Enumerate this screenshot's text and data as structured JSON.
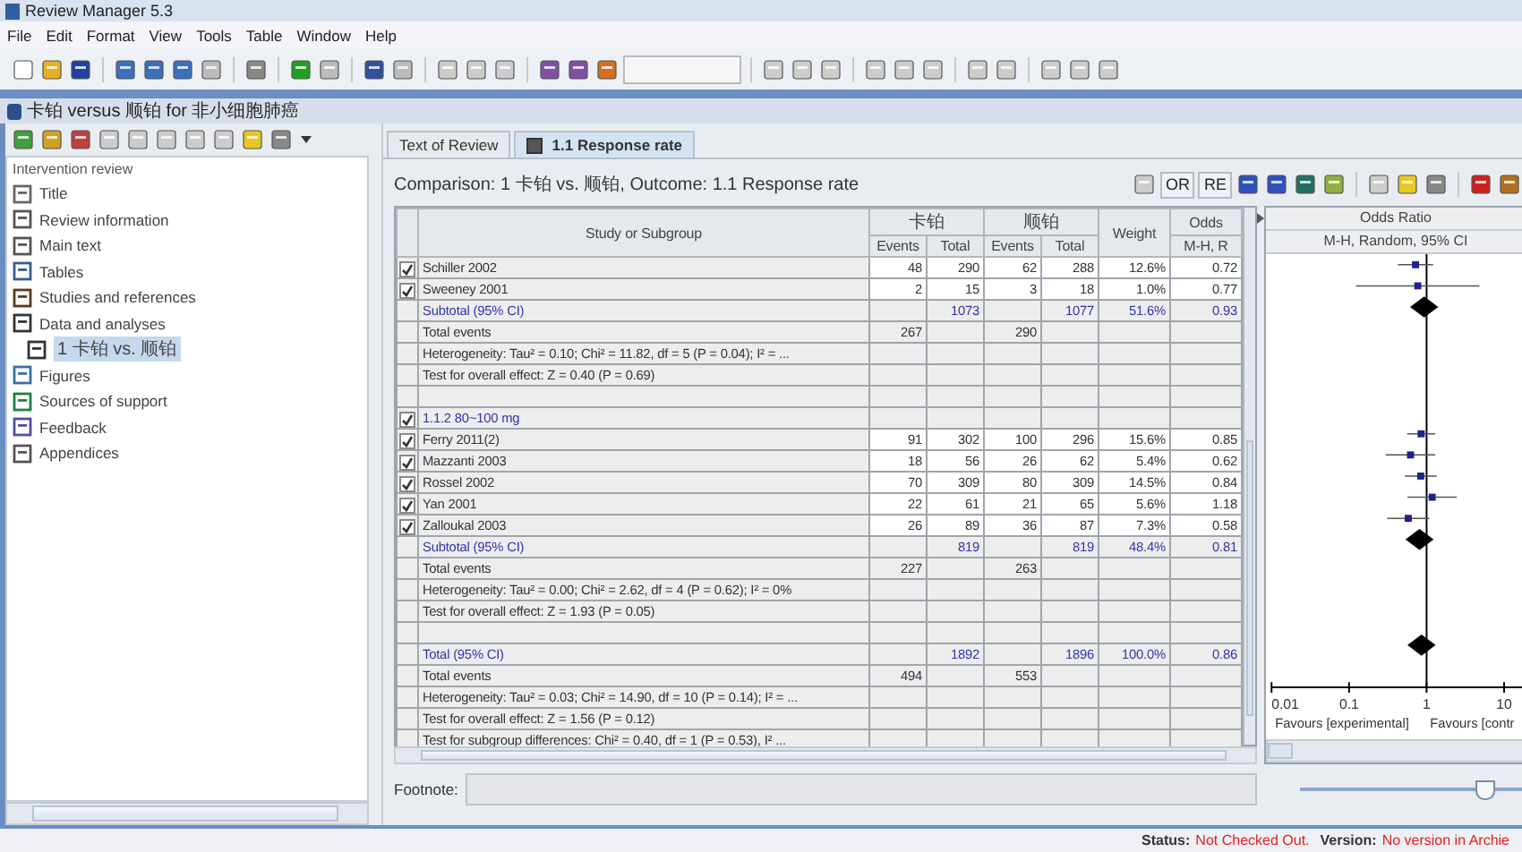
{
  "window": {
    "title": "Review Manager 5.3"
  },
  "menu": [
    "File",
    "Edit",
    "Format",
    "View",
    "Tools",
    "Table",
    "Window",
    "Help"
  ],
  "document": {
    "title": "卡铂 versus 顺铂 for 非小细胞肺癌"
  },
  "sidebar": {
    "heading": "Intervention review",
    "items": [
      {
        "label": "Title",
        "selected": false
      },
      {
        "label": "Review information",
        "selected": false
      },
      {
        "label": "Main text",
        "selected": false
      },
      {
        "label": "Tables",
        "selected": false
      },
      {
        "label": "Studies and references",
        "selected": false
      },
      {
        "label": "Data and analyses",
        "selected": false,
        "children": [
          {
            "label": "1 卡铂 vs. 顺铂",
            "selected": true
          }
        ]
      },
      {
        "label": "Figures",
        "selected": false
      },
      {
        "label": "Sources of support",
        "selected": false
      },
      {
        "label": "Feedback",
        "selected": false
      },
      {
        "label": "Appendices",
        "selected": false
      }
    ]
  },
  "tabs": [
    {
      "label": "Text of Review",
      "selected": false,
      "closable": false
    },
    {
      "label": "1.1 Response rate",
      "selected": true,
      "closable": true
    }
  ],
  "analysis": {
    "caption": "Comparison: 1 卡铂 vs. 顺铂, Outcome: 1.1 Response rate",
    "tool_buttons": [
      "OR",
      "RE"
    ]
  },
  "table": {
    "columns": {
      "study": "Study or Subgroup",
      "group1": "卡铂",
      "group2": "顺铂",
      "events1": "Events",
      "total1": "Total",
      "events2": "Events",
      "total2": "Total",
      "weight": "Weight",
      "or_top": "Odds",
      "or_sub": "M-H, R"
    },
    "rows": [
      {
        "kind": "study",
        "checked": true,
        "name": "Schiller 2002",
        "e1": "48",
        "t1": "290",
        "e2": "62",
        "t2": "288",
        "weight": "12.6%",
        "or": "0.72"
      },
      {
        "kind": "study",
        "checked": true,
        "name": "Sweeney 2001",
        "e1": "2",
        "t1": "15",
        "e2": "3",
        "t2": "18",
        "weight": "1.0%",
        "or": "0.77"
      },
      {
        "kind": "subtotal",
        "name": "Subtotal (95% CI)",
        "t1": "1073",
        "t2": "1077",
        "weight": "51.6%",
        "or": "0.93"
      },
      {
        "kind": "events",
        "name": "Total events",
        "e1": "267",
        "e2": "290"
      },
      {
        "kind": "info",
        "name": "Heterogeneity: Tau² = 0.10; Chi² = 11.82, df = 5 (P = 0.04); I² = ..."
      },
      {
        "kind": "info",
        "name": "Test for overall effect: Z = 0.40 (P = 0.69)"
      },
      {
        "kind": "blank"
      },
      {
        "kind": "group",
        "checked": true,
        "name": "1.1.2 80~100 mg"
      },
      {
        "kind": "study",
        "checked": true,
        "name": "Ferry 2011(2)",
        "e1": "91",
        "t1": "302",
        "e2": "100",
        "t2": "296",
        "weight": "15.6%",
        "or": "0.85"
      },
      {
        "kind": "study",
        "checked": true,
        "name": "Mazzanti 2003",
        "e1": "18",
        "t1": "56",
        "e2": "26",
        "t2": "62",
        "weight": "5.4%",
        "or": "0.62"
      },
      {
        "kind": "study",
        "checked": true,
        "name": "Rossel 2002",
        "e1": "70",
        "t1": "309",
        "e2": "80",
        "t2": "309",
        "weight": "14.5%",
        "or": "0.84"
      },
      {
        "kind": "study",
        "checked": true,
        "name": "Yan 2001",
        "e1": "22",
        "t1": "61",
        "e2": "21",
        "t2": "65",
        "weight": "5.6%",
        "or": "1.18"
      },
      {
        "kind": "study",
        "checked": true,
        "name": "Zalloukal 2003",
        "e1": "26",
        "t1": "89",
        "e2": "36",
        "t2": "87",
        "weight": "7.3%",
        "or": "0.58"
      },
      {
        "kind": "subtotal",
        "name": "Subtotal (95% CI)",
        "t1": "819",
        "t2": "819",
        "weight": "48.4%",
        "or": "0.81"
      },
      {
        "kind": "events",
        "name": "Total events",
        "e1": "227",
        "e2": "263"
      },
      {
        "kind": "info",
        "name": "Heterogeneity: Tau² = 0.00; Chi² = 2.62, df = 4 (P = 0.62); I² = 0%"
      },
      {
        "kind": "info",
        "name": "Test for overall effect: Z = 1.93 (P = 0.05)"
      },
      {
        "kind": "blank"
      },
      {
        "kind": "subtotal",
        "name": "Total (95% CI)",
        "t1": "1892",
        "t2": "1896",
        "weight": "100.0%",
        "or": "0.86"
      },
      {
        "kind": "events",
        "name": "Total events",
        "e1": "494",
        "e2": "553"
      },
      {
        "kind": "info",
        "name": "Heterogeneity: Tau² = 0.03; Chi² = 14.90, df = 10 (P = 0.14); I² = ..."
      },
      {
        "kind": "info",
        "name": "Test for overall effect: Z = 1.56 (P = 0.12)"
      },
      {
        "kind": "info",
        "name": "Test for subgroup differences: Chi² = 0.40, df = 1 (P = 0.53), I² ..."
      }
    ]
  },
  "forest_plot": {
    "title": "Odds Ratio",
    "subtitle": "M-H, Random, 95% CI",
    "ticks": [
      "0.01",
      "0.1",
      "1",
      "10"
    ],
    "favours_left": "Favours [experimental]",
    "favours_right": "Favours [contr",
    "zoom": {
      "level": 0.82
    }
  },
  "footnote": {
    "label": "Footnote:"
  },
  "status_bar": [
    {
      "label": "Status:",
      "value": "Not Checked Out."
    },
    {
      "label": "Version:",
      "value": "No version in Archie"
    }
  ]
}
